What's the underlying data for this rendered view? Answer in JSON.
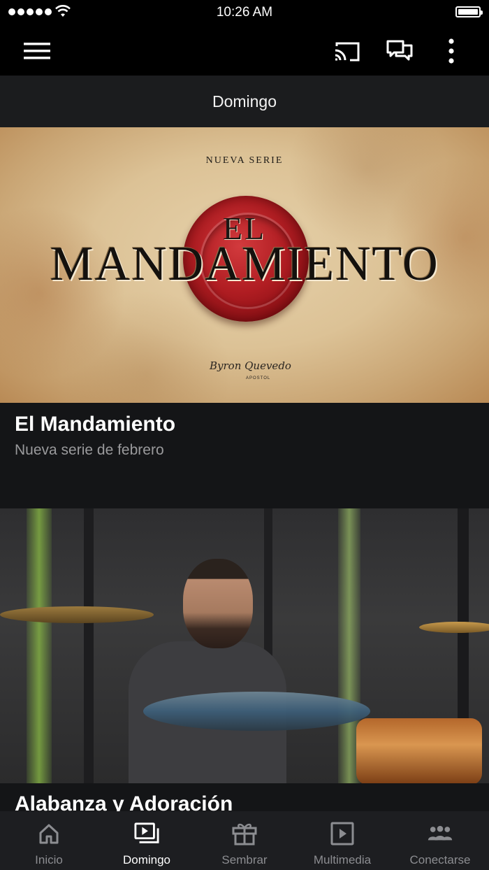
{
  "status_bar": {
    "time": "10:26 AM"
  },
  "toolbar": {
    "menu_icon": "hamburger-icon",
    "cast_icon": "cast-icon",
    "chat_icon": "chat-icon",
    "more_icon": "more-vertical-icon"
  },
  "page": {
    "title": "Domingo"
  },
  "cards": [
    {
      "image": {
        "kicker": "NUEVA SERIE",
        "title_top": "EL",
        "title_main": "MANDAMIENTO",
        "signature": "Byron Quevedo",
        "signature_sub": "APOSTOL"
      },
      "title": "El Mandamiento",
      "subtitle": "Nueva serie de febrero"
    },
    {
      "title": "Alabanza y Adoración"
    }
  ],
  "tabs": [
    {
      "label": "Inicio",
      "icon": "home-icon",
      "active": false
    },
    {
      "label": "Domingo",
      "icon": "video-library-icon",
      "active": true
    },
    {
      "label": "Sembrar",
      "icon": "gift-icon",
      "active": false
    },
    {
      "label": "Multimedia",
      "icon": "play-icon",
      "active": false
    },
    {
      "label": "Conectarse",
      "icon": "group-icon",
      "active": false
    }
  ],
  "colors": {
    "background": "#141517",
    "toolbar": "#000000",
    "tabbar": "#1d1e21",
    "seal_red": "#b01d22",
    "inactive_tab": "#8c8d91"
  }
}
